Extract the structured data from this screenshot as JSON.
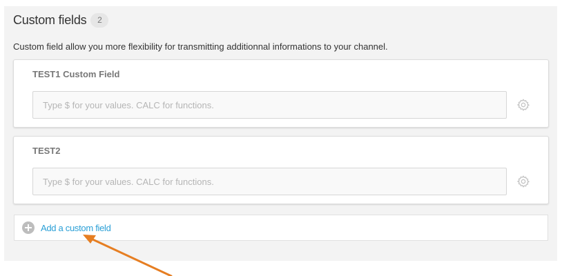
{
  "section": {
    "title": "Custom fields",
    "count": "2",
    "description": "Custom field allow you more flexibility for transmitting additionnal informations to your channel."
  },
  "fields": [
    {
      "label": "TEST1 Custom Field",
      "value": "",
      "placeholder": "Type $ for your values. CALC for functions.",
      "icon": "gear-icon"
    },
    {
      "label": "TEST2",
      "value": "",
      "placeholder": "Type $ for your values. CALC for functions.",
      "icon": "gear-icon"
    }
  ],
  "add_field": {
    "label": "Add a custom field",
    "icon": "plus-circle-icon"
  },
  "annotation": {
    "icon": "arrow-icon",
    "color": "#e67e22"
  },
  "colors": {
    "link": "#2a9fd6",
    "panel_bg": "#f3f3f3",
    "badge_bg": "#e6e6e6"
  }
}
